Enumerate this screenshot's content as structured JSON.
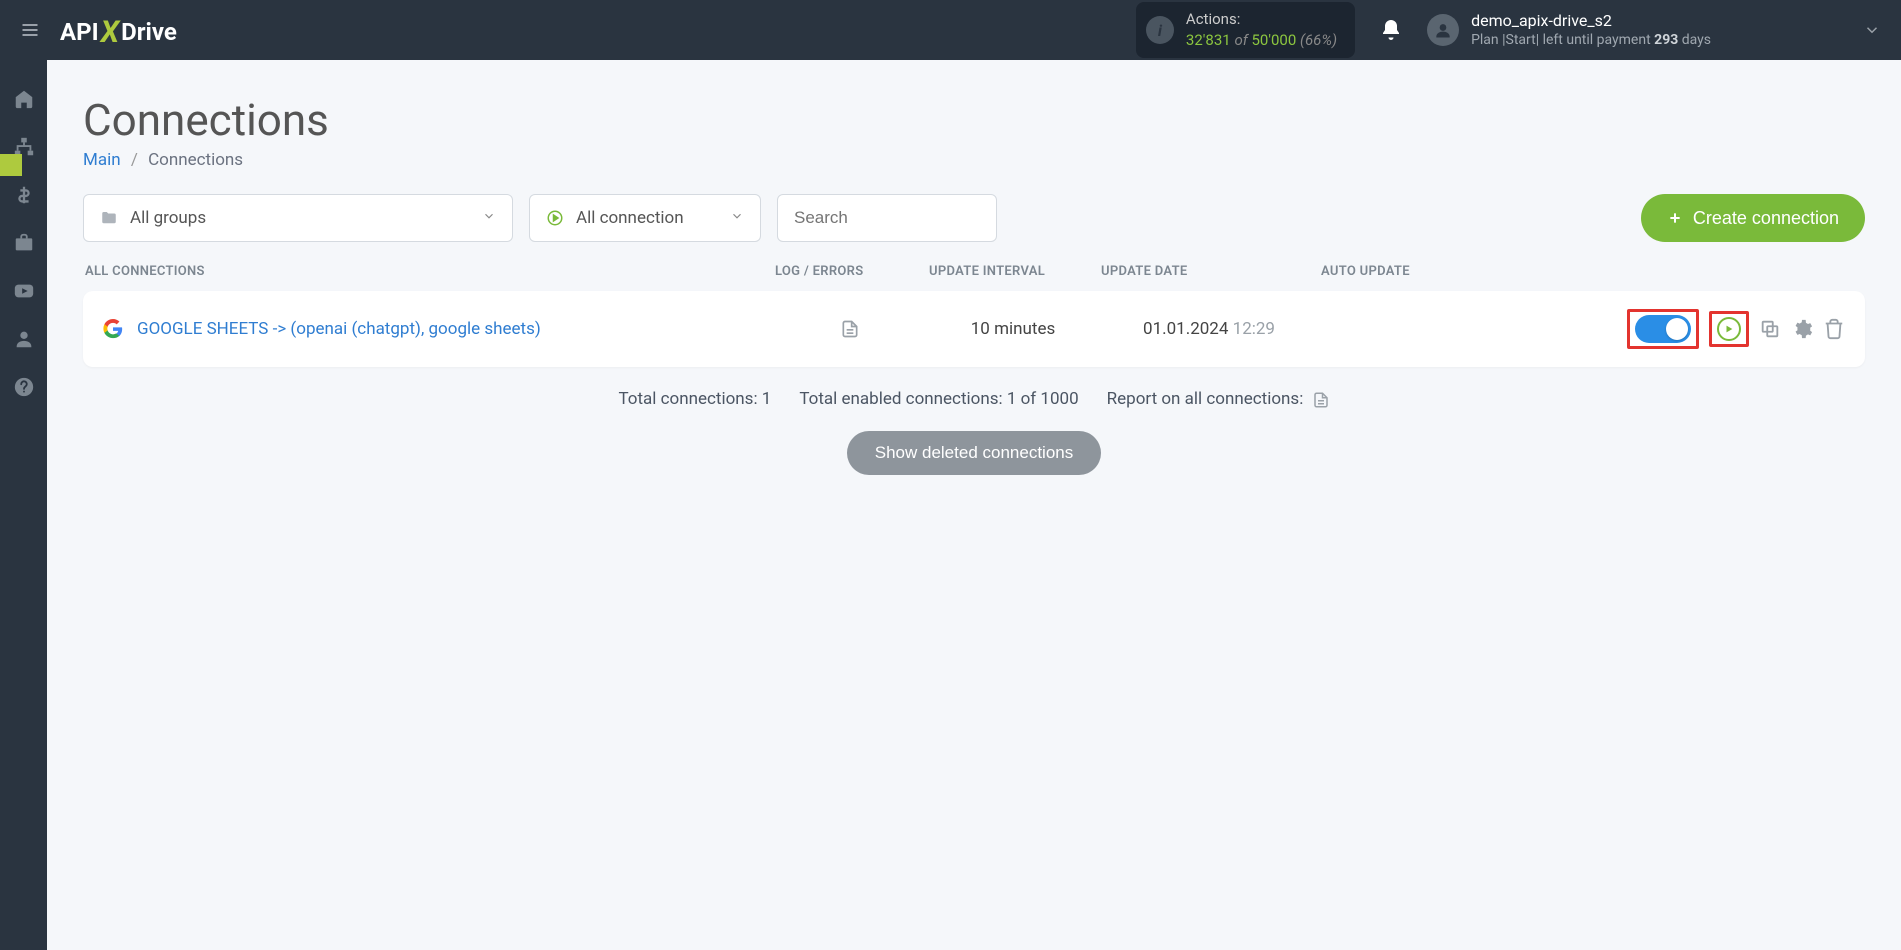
{
  "logo_parts": {
    "a": "API",
    "x": "X",
    "b": "Drive"
  },
  "actions_box": {
    "label": "Actions:",
    "used": "32'831",
    "of": "of ",
    "quota": "50'000",
    "percent": "(66%)"
  },
  "user": {
    "name": "demo_apix-drive_s2",
    "plan_prefix": "Plan |Start| left until payment ",
    "plan_days_number": "293",
    "plan_days_word": " days"
  },
  "page": {
    "title": "Connections",
    "breadcrumb_main": "Main",
    "breadcrumb_current": "Connections"
  },
  "filters": {
    "groups": "All groups",
    "connection_status": "All connection",
    "search_placeholder": "Search"
  },
  "create_button": "Create connection",
  "table": {
    "headers": {
      "name": "ALL CONNECTIONS",
      "log": "LOG / ERRORS",
      "interval": "UPDATE INTERVAL",
      "date": "UPDATE DATE",
      "auto": "AUTO UPDATE"
    },
    "rows": [
      {
        "name": "GOOGLE SHEETS -> (openai (chatgpt), google sheets)",
        "interval": "10 minutes",
        "date": "01.01.2024",
        "time": "12:29",
        "auto_update_on": true
      }
    ]
  },
  "summary": {
    "total": "Total connections: 1",
    "enabled": "Total enabled connections: 1 of 1000",
    "report": "Report on all connections:"
  },
  "show_deleted": "Show deleted connections"
}
